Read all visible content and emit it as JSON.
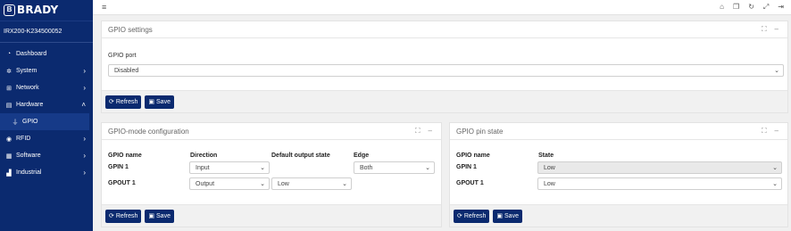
{
  "brand": {
    "mark": "B",
    "name": "BRADY"
  },
  "device_name": "IRX200-K234500052",
  "sidebar": {
    "items": [
      {
        "label": "Dashboard",
        "icon": "dashboard-icon"
      },
      {
        "label": "System",
        "icon": "gear-icon"
      },
      {
        "label": "Network",
        "icon": "network-icon"
      },
      {
        "label": "Hardware",
        "icon": "hardware-icon"
      },
      {
        "label": "GPIO",
        "icon": "plug-icon"
      },
      {
        "label": "RFID",
        "icon": "rfid-icon"
      },
      {
        "label": "Software",
        "icon": "grid-icon"
      },
      {
        "label": "Industrial",
        "icon": "factory-icon"
      }
    ]
  },
  "gpio_settings": {
    "title": "GPIO settings",
    "port_label": "GPIO port",
    "port_value": "Disabled",
    "refresh_label": "Refresh",
    "save_label": "Save"
  },
  "gpio_mode": {
    "title": "GPIO-mode configuration",
    "headers": [
      "GPIO name",
      "Direction",
      "Default output state",
      "Edge"
    ],
    "rows": [
      {
        "name": "GPIN 1",
        "direction": "Input",
        "default_output": "",
        "edge": "Both"
      },
      {
        "name": "GPOUT 1",
        "direction": "Output",
        "default_output": "Low",
        "edge": ""
      }
    ],
    "refresh_label": "Refresh",
    "save_label": "Save"
  },
  "pin_state": {
    "title": "GPIO pin state",
    "headers": [
      "GPIO name",
      "State"
    ],
    "rows": [
      {
        "name": "GPIN 1",
        "state": "Low"
      },
      {
        "name": "GPOUT 1",
        "state": "Low"
      }
    ],
    "refresh_label": "Refresh",
    "save_label": "Save"
  }
}
